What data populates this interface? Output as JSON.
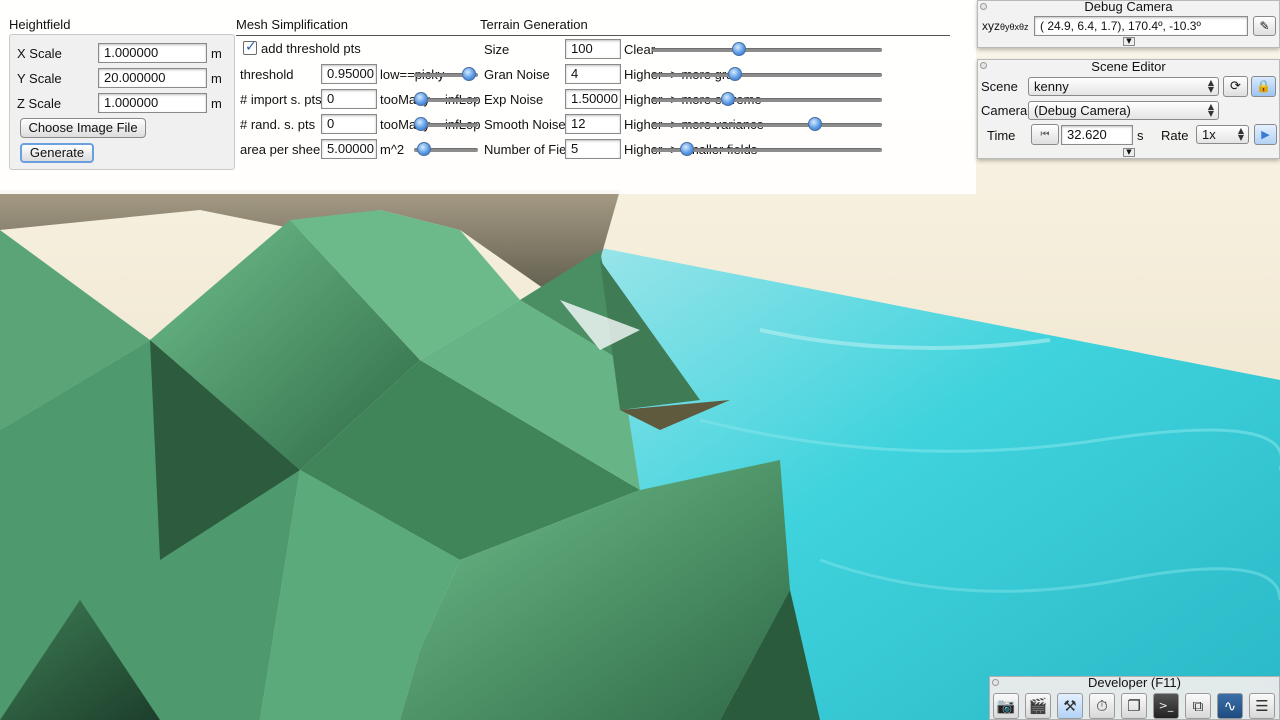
{
  "heightfield": {
    "title": "Heightfield",
    "x_scale": {
      "label": "X Scale",
      "value": "1.000000",
      "unit": "m"
    },
    "y_scale": {
      "label": "Y Scale",
      "value": "20.000000",
      "unit": "m"
    },
    "z_scale": {
      "label": "Z Scale",
      "value": "1.000000",
      "unit": "m"
    },
    "choose_button": "Choose Image File",
    "generate_button": "Generate"
  },
  "mesh": {
    "title": "Mesh Simplification",
    "add_threshold": {
      "label": "add threshold pts",
      "checked": true
    },
    "threshold": {
      "label": "threshold",
      "value": "0.95000",
      "hint": "low==picky",
      "slider": 0.95
    },
    "import_pts": {
      "label": "# import s. pts",
      "value": "0",
      "hint": "tooMany==infLop",
      "slider": 0.0
    },
    "rand_pts": {
      "label": "# rand. s. pts",
      "value": "0",
      "hint": "tooMany==infLop",
      "slider": 0.0
    },
    "area_sheep": {
      "label": "area per sheep",
      "value": "5.00000",
      "hint": "m^2",
      "slider": 0.05
    }
  },
  "terrain": {
    "title": "Terrain Generation",
    "size": {
      "label": "Size",
      "value": "100",
      "hint": "Clear",
      "slider": 0.37
    },
    "gran": {
      "label": "Gran Noise",
      "value": "4",
      "hint": "Higher -> more gran",
      "slider": 0.35
    },
    "exp": {
      "label": "Exp Noise",
      "value": "1.50000",
      "hint": "Higher -> more extreme",
      "slider": 0.32
    },
    "smooth": {
      "label": "Smooth Noise",
      "value": "12",
      "hint": "Higher -> more variance",
      "slider": 0.72
    },
    "fields": {
      "label": "Number of Fields",
      "value": "5",
      "hint": "Higher -> smaller fields",
      "slider": 0.13
    }
  },
  "debug_camera": {
    "title": "Debug Camera",
    "coord_label": "xyz",
    "coord_suffix": "θyθxθz",
    "coords": "( 24.9,   6.4,   1.7),  170.4º, -10.3º"
  },
  "scene_editor": {
    "title": "Scene Editor",
    "scene_label": "Scene",
    "scene_value": "kenny",
    "camera_label": "Camera",
    "camera_value": "(Debug Camera)",
    "time_label": "Time",
    "time_value": "32.620",
    "time_unit": "s",
    "rate_label": "Rate",
    "rate_value": "1x"
  },
  "developer": {
    "title": "Developer (F11)",
    "icons": [
      "camera-icon",
      "clapperboard-icon",
      "tools-icon",
      "stopwatch-icon",
      "note-icon",
      "terminal-icon",
      "windows-icon",
      "waveform-icon",
      "document-icon"
    ]
  },
  "colors": {
    "water": "#35d2dc",
    "terrain_green": "#4f9a6c",
    "sky": "#f3ecd8",
    "slider_knob": "#5b9be6"
  }
}
